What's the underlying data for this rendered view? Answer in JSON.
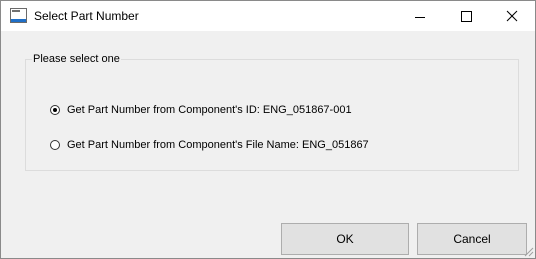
{
  "window": {
    "title": "Select Part Number",
    "minimize_label": "Minimize",
    "maximize_label": "Maximize",
    "close_label": "Close"
  },
  "group": {
    "legend": "Please select one",
    "options": [
      {
        "label": "Get Part Number from Component's ID: ENG_051867-001",
        "selected": true
      },
      {
        "label": "Get Part Number from Component's File Name: ENG_051867",
        "selected": false
      }
    ]
  },
  "buttons": {
    "ok_label": "OK",
    "cancel_label": "Cancel"
  },
  "colors": {
    "dialog_background": "#f0f0f0",
    "title_background": "#ffffff",
    "button_background": "#e1e1e1",
    "button_border": "#adadad",
    "icon_accent": "#1f6fc7"
  },
  "icons": {
    "app": "dialog-window-icon",
    "minimize": "minimize-icon",
    "maximize": "maximize-icon",
    "close": "close-icon",
    "resize": "resize-grip-icon"
  }
}
